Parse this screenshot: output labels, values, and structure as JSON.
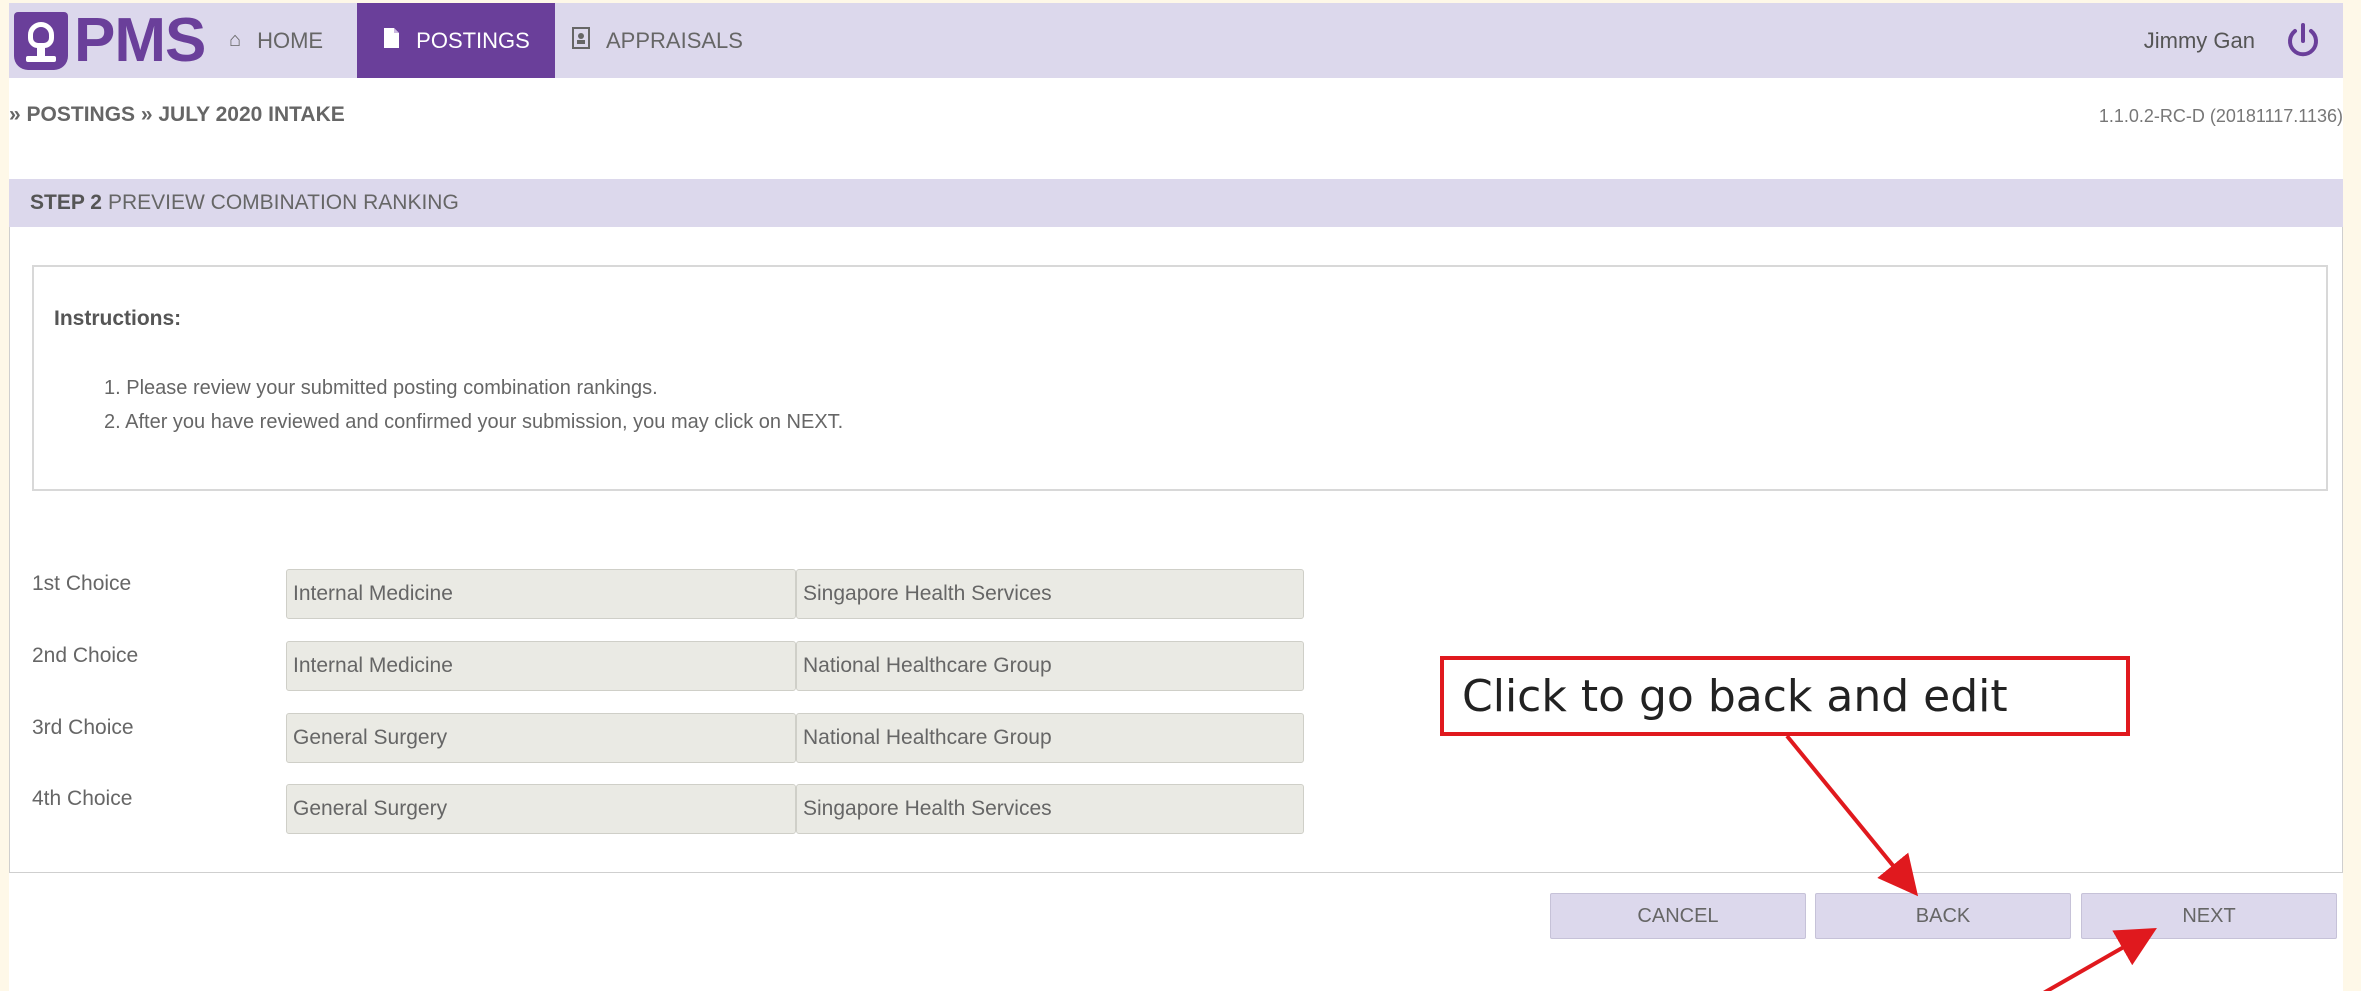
{
  "app": {
    "logo_text": "PMS"
  },
  "nav": {
    "items": [
      {
        "label": "HOME",
        "icon": "home-icon"
      },
      {
        "label": "POSTINGS",
        "icon": "document-icon",
        "active": true
      },
      {
        "label": "APPRAISALS",
        "icon": "badge-icon"
      }
    ],
    "user_name": "Jimmy Gan",
    "logout_icon": "power-icon"
  },
  "breadcrumb": "» POSTINGS » JULY 2020 INTAKE",
  "version": "1.1.0.2-RC-D (20181117.1136)",
  "step": {
    "number": "STEP 2",
    "title": "PREVIEW COMBINATION RANKING"
  },
  "instructions": {
    "title": "Instructions:",
    "items": [
      "1. Please review your submitted posting combination rankings.",
      "2. After you have reviewed and confirmed your submission, you may click on NEXT."
    ]
  },
  "choices": [
    {
      "label": "1st Choice",
      "specialty": "Internal Medicine",
      "cluster": "Singapore Health Services"
    },
    {
      "label": "2nd Choice",
      "specialty": "Internal Medicine",
      "cluster": "National Healthcare Group"
    },
    {
      "label": "3rd Choice",
      "specialty": "General Surgery",
      "cluster": "National Healthcare Group"
    },
    {
      "label": "4th Choice",
      "specialty": "General Surgery",
      "cluster": "Singapore Health Services"
    }
  ],
  "buttons": {
    "cancel": "CANCEL",
    "back": "BACK",
    "next": "NEXT"
  },
  "annotation": {
    "text": "Click to go back and edit",
    "color": "#e0191e"
  },
  "colors": {
    "brand": "#6a3f9a",
    "bar": "#dcd8ec",
    "field": "#eaeae4"
  }
}
